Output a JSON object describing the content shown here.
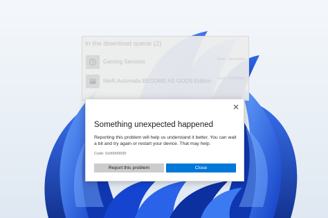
{
  "colors": {
    "accent": "#0078d7",
    "secondary_button": "#cccccc",
    "bloom_dark": "#0a2a8c",
    "bloom_mid": "#1a4fd8",
    "bloom_light": "#4f8df5"
  },
  "store": {
    "queue_title": "In the download queue (2)",
    "items": [
      {
        "name": "Gaming Services",
        "status": "Error · Get details",
        "icon": "gaming-services-icon"
      },
      {
        "name": "NieR:Automata BECOME AS GODS Edition",
        "status": "Error · Get details",
        "icon": "game-thumbnail-icon"
      }
    ]
  },
  "dialog": {
    "title": "Something unexpected happened",
    "message": "Reporting this problem will help us understand it better. You can wait a bit and try again or restart your device. That may help.",
    "code": "Code: 0x00000000",
    "report_button": "Report this problem",
    "close_button": "Close",
    "close_icon": "close-icon"
  }
}
